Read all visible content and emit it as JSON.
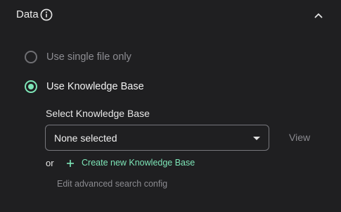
{
  "section": {
    "title": "Data",
    "info_icon": "info-icon",
    "collapse_icon": "chevron-up-icon"
  },
  "options": {
    "single_file": {
      "label": "Use single file only",
      "selected": false
    },
    "knowledge_base": {
      "label": "Use Knowledge Base",
      "selected": true
    }
  },
  "knowledge_base_select": {
    "label": "Select Knowledge Base",
    "value": "None selected",
    "view_label": "View"
  },
  "create": {
    "or_text": "or",
    "icon": "plus-icon",
    "link_label": "Create new Knowledge Base"
  },
  "advanced": {
    "link_label": "Edit advanced search config"
  },
  "colors": {
    "background": "#1f1f21",
    "accent": "#7ee6b8",
    "muted": "#8a8a8f"
  }
}
